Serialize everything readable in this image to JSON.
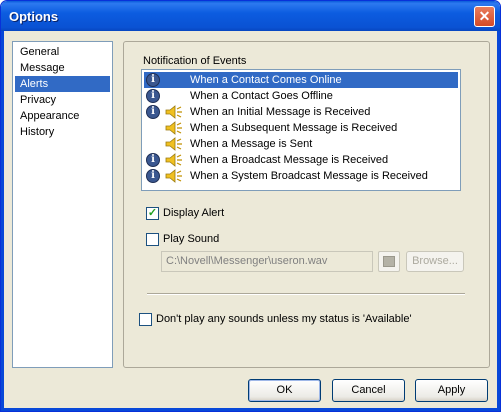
{
  "window": {
    "title": "Options"
  },
  "sidebar": {
    "items": [
      {
        "label": "General"
      },
      {
        "label": "Message"
      },
      {
        "label": "Alerts"
      },
      {
        "label": "Privacy"
      },
      {
        "label": "Appearance"
      },
      {
        "label": "History"
      }
    ],
    "selected": "Alerts"
  },
  "alerts": {
    "section_label": "Notification of Events",
    "events": [
      {
        "label": "When a Contact Comes Online",
        "icons": [
          "info-icon"
        ],
        "selected": true
      },
      {
        "label": "When a Contact Goes Offline",
        "icons": [
          "info-icon"
        ],
        "selected": false
      },
      {
        "label": "When an Initial Message is Received",
        "icons": [
          "info-icon",
          "speaker-icon"
        ],
        "selected": false
      },
      {
        "label": "When a Subsequent Message is Received",
        "icons": [
          "speaker-icon"
        ],
        "selected": false
      },
      {
        "label": "When a Message is Sent",
        "icons": [
          "speaker-icon"
        ],
        "selected": false
      },
      {
        "label": "When a Broadcast Message is Received",
        "icons": [
          "info-icon",
          "speaker-icon"
        ],
        "selected": false
      },
      {
        "label": "When a System Broadcast Message is Received",
        "icons": [
          "info-icon",
          "speaker-icon"
        ],
        "selected": false
      }
    ],
    "display_alert": {
      "label": "Display Alert",
      "checked": true
    },
    "play_sound": {
      "label": "Play Sound",
      "checked": false
    },
    "sound_path": "C:\\Novell\\Messenger\\useron.wav",
    "browse_label": "Browse...",
    "status_only": {
      "label": "Don't play any sounds unless my status is 'Available'",
      "checked": false
    }
  },
  "buttons": {
    "ok": "OK",
    "cancel": "Cancel",
    "apply": "Apply"
  },
  "colors": {
    "selection": "#316ac5",
    "titlebar": "#0a52d3",
    "face": "#ece9d8"
  }
}
